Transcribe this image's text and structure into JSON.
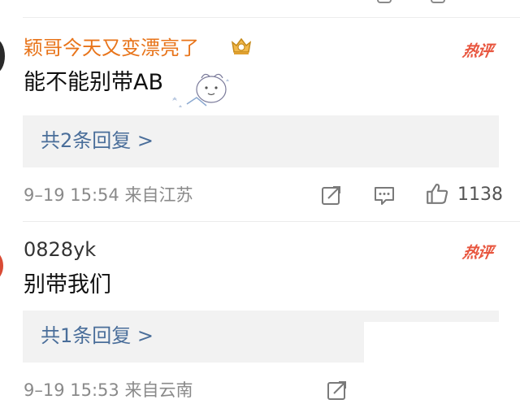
{
  "comments": [
    {
      "username": "颖哥今天又变漂亮了",
      "badge": "热评",
      "text": "能不能别带AB",
      "reply_link": "共2条回复 >",
      "time": "9–19 15:54",
      "location": "来自江苏",
      "likes": "1138"
    },
    {
      "username": "0828yk",
      "badge": "热评",
      "text": "别带我们",
      "reply_link": "共1条回复 >",
      "time": "9–19 15:53",
      "location": "来自云南"
    }
  ],
  "colors": {
    "vip_name": "#e8741a",
    "hot_badge": "#e8553e",
    "reply_link": "#4a6e9a",
    "meta": "#8a8a8a"
  },
  "icons": [
    "crown-badge-icon",
    "sticker-icon",
    "share-icon",
    "comment-icon",
    "like-icon"
  ]
}
